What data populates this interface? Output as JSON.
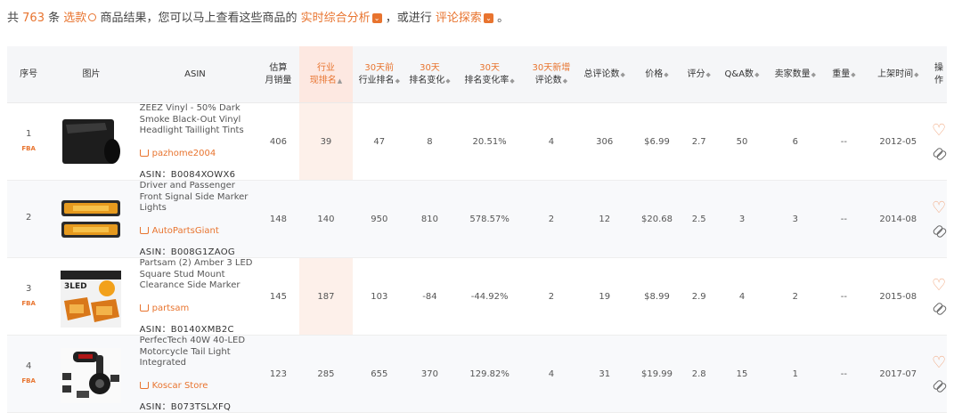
{
  "summary": {
    "prefix": "共",
    "count": "763",
    "mid1": "条",
    "filter_label": "选款",
    "mid2": "商品结果，您可以马上查看这些商品的",
    "analysis_label": "实时综合分析",
    "mid3": "，或进行",
    "review_label": "评论探索",
    "suffix": "。"
  },
  "columns": {
    "index": "序号",
    "image": "图片",
    "asin": "ASIN",
    "est_sales_1": "估算",
    "est_sales_2": "月销量",
    "cat_rank_1": "行业",
    "cat_rank_2": "现排名",
    "rank30_1": "30天前",
    "rank30_2": "行业排名",
    "rankchg_1": "30天",
    "rankchg_2": "排名变化",
    "rankrate_1": "30天",
    "rankrate_2": "排名变化率",
    "newrev_1": "30天新增",
    "newrev_2": "评论数",
    "total_reviews": "总评论数",
    "price": "价格",
    "rating": "评分",
    "qa": "Q&A数",
    "sellers": "卖家数量",
    "weight": "重量",
    "listed": "上架时间",
    "action": "操作"
  },
  "rows": [
    {
      "index": "1",
      "fba": "FBA",
      "title": "ZEEZ Vinyl - 50% Dark Smoke Black-Out Vinyl Headlight Taillight Tints",
      "seller": "pazhome2004",
      "asin_prefix": "ASIN：",
      "asin": "B0084XOWX6",
      "sales": "406",
      "rank": "39",
      "rank30": "47",
      "rank_change": "8",
      "rank_rate": "20.51%",
      "new_reviews": "4",
      "total_reviews": "306",
      "price": "$6.99",
      "rating": "2.7",
      "qa": "50",
      "sellers": "6",
      "weight": "--",
      "listed": "2012-05"
    },
    {
      "index": "2",
      "fba": "",
      "title": "Driver and Passenger Front Signal Side Marker Lights",
      "seller": "AutoPartsGiant",
      "asin_prefix": "ASIN：",
      "asin": "B008G1ZAOG",
      "sales": "148",
      "rank": "140",
      "rank30": "950",
      "rank_change": "810",
      "rank_rate": "578.57%",
      "new_reviews": "2",
      "total_reviews": "12",
      "price": "$20.68",
      "rating": "2.5",
      "qa": "3",
      "sellers": "3",
      "weight": "--",
      "listed": "2014-08"
    },
    {
      "index": "3",
      "fba": "FBA",
      "title": "Partsam (2) Amber 3 LED Square Stud Mount Clearance Side Marker",
      "seller": "partsam",
      "asin_prefix": "ASIN：",
      "asin": "B0140XMB2C",
      "sales": "145",
      "rank": "187",
      "rank30": "103",
      "rank_change": "-84",
      "rank_rate": "-44.92%",
      "new_reviews": "2",
      "total_reviews": "19",
      "price": "$8.99",
      "rating": "2.9",
      "qa": "4",
      "sellers": "2",
      "weight": "--",
      "listed": "2015-08"
    },
    {
      "index": "4",
      "fba": "FBA",
      "title": "PerfecTech 40W 40-LED Motorcycle Tail Light Integrated",
      "seller": "Koscar Store",
      "asin_prefix": "ASIN：",
      "asin": "B073TSLXFQ",
      "sales": "123",
      "rank": "285",
      "rank30": "655",
      "rank_change": "370",
      "rank_rate": "129.82%",
      "new_reviews": "4",
      "total_reviews": "31",
      "price": "$19.99",
      "rating": "2.8",
      "qa": "15",
      "sellers": "1",
      "weight": "--",
      "listed": "2017-07"
    }
  ],
  "image_labels": {
    "row3": "3LED"
  },
  "icons": {
    "favorite": "heart-outline-icon",
    "link": "link-icon",
    "cart": "cart-icon"
  },
  "colors": {
    "accent": "#e8742f",
    "highlight_column": "#fdf0ea",
    "header_bg": "#f5f6f8"
  }
}
